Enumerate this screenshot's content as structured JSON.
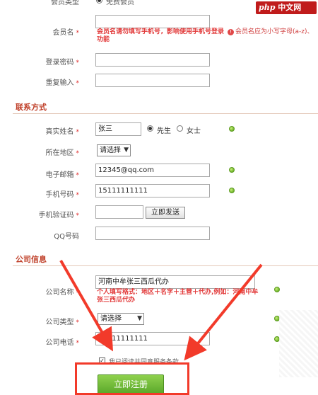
{
  "logo": {
    "php": "php",
    "site": "中文网"
  },
  "top": {
    "cut_label": "会员类型",
    "cut_option": "免费会员"
  },
  "member": {
    "username_label": "会员名",
    "username_value": "",
    "username_warning": "会员名请勿填写手机号，影响使用手机号登录功能",
    "username_tip": "会员名应为小写字母(a-z)、",
    "password_label": "登录密码",
    "password_value": "",
    "repeat_label": "重复输入",
    "repeat_value": "",
    "required_mark": "*"
  },
  "contact": {
    "title": "联系方式",
    "realname_label": "真实姓名",
    "realname_value": "张三",
    "gender_male": "先生",
    "gender_female": "女士",
    "region_label": "所在地区",
    "region_select": "请选择",
    "email_label": "电子邮箱",
    "email_value": "12345@qq.com",
    "phone_label": "手机号码",
    "phone_value": "15111111111",
    "code_label": "手机验证码",
    "code_value": "",
    "send_button": "立即发送",
    "qq_label": "QQ号码",
    "qq_value": ""
  },
  "company": {
    "title": "公司信息",
    "name_label": "公司名称",
    "name_value": "河南中牟张三西瓜代办",
    "name_hint": "个人填写格式：地区＋名字＋主营＋代办,例如：河南中牟张三西瓜代办",
    "type_label": "公司类型",
    "type_select": "请选择",
    "tel_label": "公司电话",
    "tel_value": "15111111111",
    "agree_text": "我已阅读并同意服务条款"
  },
  "submit": {
    "label": "立即注册"
  },
  "colors": {
    "accent": "#c0402a",
    "warning": "#e23a3a",
    "submit": "#6cb83a",
    "annotation": "#f23a2a"
  }
}
